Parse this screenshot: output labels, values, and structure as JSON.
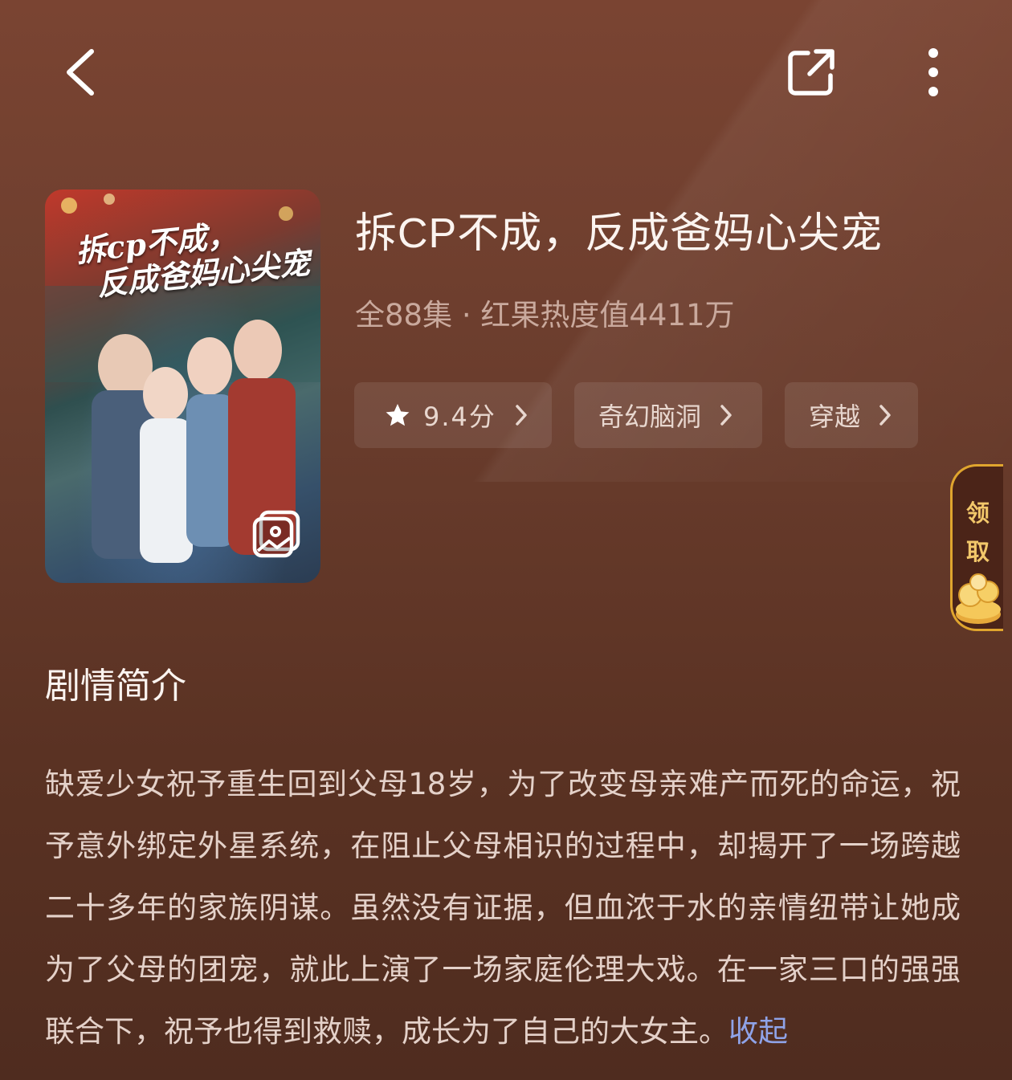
{
  "header": {
    "back_icon": "chevron-left-icon",
    "share_icon": "share-icon",
    "more_icon": "more-vertical-icon"
  },
  "poster": {
    "title_line1": "拆cp不成，",
    "title_line2": "反成爸妈心尖宠",
    "gallery_icon": "gallery-icon"
  },
  "drama": {
    "title": "拆CP不成，反成爸妈心尖宠",
    "meta": "全88集 · 红果热度值4411万",
    "rating": "9.4分",
    "genres": [
      "奇幻脑洞",
      "穿越"
    ]
  },
  "claim_badge": {
    "line1": "领",
    "line2": "取"
  },
  "synopsis": {
    "heading": "剧情简介",
    "text": "缺爱少女祝予重生回到父母18岁，为了改变母亲难产而死的命运，祝予意外绑定外星系统，在阻止父母相识的过程中，却揭开了一场跨越二十多年的家族阴谋。虽然没有证据，但血浓于水的亲情纽带让她成为了父母的团宠，就此上演了一场家庭伦理大戏。在一家三口的强强联合下，祝予也得到救赎，成长为了自己的大女主。",
    "collapse_label": "收起"
  },
  "colors": {
    "background_top": "#7a4432",
    "background_bottom": "#4f2c1f",
    "link_blue": "#8fa3e8",
    "claim_gold": "#e0a52e"
  }
}
